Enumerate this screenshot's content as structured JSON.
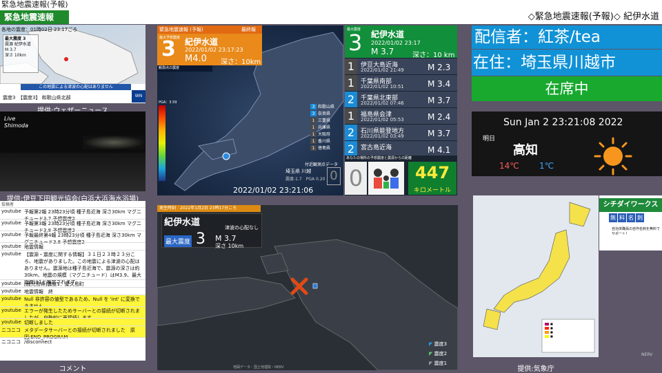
{
  "top": {
    "title": "緊急地震速報(予報)"
  },
  "ticker": {
    "label": "緊急地震速報",
    "text": "◇緊急地震速報(予報)◇ 紀伊水道"
  },
  "weathernews": {
    "header": "各地の震度：01時02日 23:17ごろ",
    "box_title": "最大震度 3",
    "box_lines": [
      "震源 紀伊水道",
      "M 3.7",
      "深さ 10km"
    ],
    "banner": "この地震による津波の心配はありません",
    "footer": "震度3　【震度3】 和歌山県北部",
    "logo": "WN",
    "caption": "提供:ウェザーニュース"
  },
  "camera": {
    "logo": "Live Shimoda",
    "caption": "提供:伊豆下田観光協会(白浜大浜海水浴場)"
  },
  "comments": {
    "header": "投稿者",
    "rows": [
      {
        "src": "youtube",
        "msg": "予報第2報 23時23分頃 種子島近海 深さ30km マグニチュード3.7 予想震度2",
        "yellow": false
      },
      {
        "src": "youtube",
        "msg": "予報第3報 23時23分頃 種子島近海 深さ30km マグニチュード3.8 予想震度2",
        "yellow": false
      },
      {
        "src": "youtube",
        "msg": "予報最終第4報 23時23分頃 種子島近海 深さ30km マグニチュード3.8 予想震度2",
        "yellow": false
      },
      {
        "src": "youtube",
        "msg": "地震情報",
        "yellow": false
      },
      {
        "src": "youtube",
        "msg": "【震源・震度に関する情報】３１日２３時２３分ころ、地震がありました。この地震による津波の心配はありません。震源地は種子島近海で、震源の深さは約30km、地震の規模（マグニチュード）はM3.9、最大震度は1と推定されます。",
        "yellow": false
      },
      {
        "src": "youtube",
        "msg": "[鹿児島県]震度1：屋久島町",
        "yellow": false
      },
      {
        "src": "youtube",
        "msg": "地震情報　終",
        "yellow": false
      },
      {
        "src": "youtube",
        "msg": "Null 非許容の値型であるため、Null を 'int' に変換できません",
        "yellow": true
      },
      {
        "src": "youtube",
        "msg": "エラーが発生したためサーバーとの接続が切断されましたが、自動的に再接続します",
        "yellow": true
      },
      {
        "src": "youtube",
        "msg": "切断しました",
        "yellow": true
      },
      {
        "src": "ニコニコ",
        "msg": "メタデータサーバーとの接続が切断されました　原因:END_PROGRAM",
        "yellow": true
      },
      {
        "src": "ニコニコ",
        "msg": "/disconnect",
        "yellow": false
      }
    ],
    "caption": "コメント"
  },
  "main": {
    "head": "緊急地震速報 (予報)",
    "final": "最終報",
    "int_label": "最大予想震度",
    "intensity": "3",
    "name": "紀伊水道",
    "time": "2022/01/02 23:17:23",
    "mag": "M4.0",
    "depth": "深さ：10km",
    "legend_head": "観測点の震度",
    "pga": "PGA：3.59",
    "cities": [
      {
        "n": "3",
        "name": "和歌山県",
        "color": "#1a8bd6"
      },
      {
        "n": "3",
        "name": "奈良県",
        "color": "#1a8bd6"
      },
      {
        "n": "1",
        "name": "三重県",
        "color": "#4a4a4a"
      },
      {
        "n": "1",
        "name": "兵庫県",
        "color": "#4a4a4a"
      },
      {
        "n": "1",
        "name": "大阪府",
        "color": "#4a4a4a"
      },
      {
        "n": "1",
        "name": "香川県",
        "color": "#4a4a4a"
      },
      {
        "n": "1",
        "name": "徳島県",
        "color": "#4a4a4a"
      }
    ],
    "nearby_label": "付近観測点データ",
    "nearby": "埼玉県 川越",
    "nearby_pga": "震度-1.7　PGA 0.20",
    "nearby_val": "0",
    "clock": "2022/01/02 23:21:06"
  },
  "list": {
    "label": "最大震度",
    "intensity": "3",
    "name": "紀伊水道",
    "time": "2022/01/02 23:17",
    "mag": "M 3.7",
    "depth": "深さ：10 km",
    "items": [
      {
        "n": "1",
        "place": "伊豆大島近海",
        "time": "2022/01/02 21:49",
        "mag": "M 2.3",
        "color": "#4a4a4a"
      },
      {
        "n": "1",
        "place": "千葉県南部",
        "time": "2022/01/02 10:51",
        "mag": "M 3.4",
        "color": "#4a4a4a"
      },
      {
        "n": "2",
        "place": "千葉県北東部",
        "time": "2022/01/02 07:46",
        "mag": "M 3.7",
        "color": "#1a8bd6"
      },
      {
        "n": "1",
        "place": "福島県会津",
        "time": "2022/01/02 05:53",
        "mag": "M 2.4",
        "color": "#4a4a4a"
      },
      {
        "n": "2",
        "place": "石川県能登地方",
        "time": "2022/01/02 03:49",
        "mag": "M 3.7",
        "color": "#1a8bd6"
      },
      {
        "n": "2",
        "place": "宮古島近海",
        "time": "",
        "mag": "M 4.1",
        "color": "#1a8bd6"
      }
    ],
    "dist_head": "あなたの場所の予想震度と震源からの距離",
    "dist_int": "0",
    "dist_km": "447",
    "dist_unit": "キロメートル"
  },
  "streamer": {
    "name": "配信者：紅茶/tea",
    "home": "在住：埼玉県川越市",
    "status": "在席中"
  },
  "clockweather": {
    "clock": "Sun Jan  2 23:21:08 2022",
    "tomorrow": "明日",
    "city": "高知",
    "hi": "14℃",
    "lo": "1℃"
  },
  "jma": {
    "caption": "提供:気象庁",
    "credit": "NERV"
  },
  "ad": {
    "title": "シチダイワークス",
    "tags": [
      "無",
      "料",
      "名",
      "刺"
    ],
    "text": "自治体職員の自作名刺を無料でサポート！"
  },
  "bottom": {
    "head": "発生時刻　2022年1月2日 23時17分ころ",
    "name": "紀伊水道",
    "int_label": "最大震度",
    "intensity": "3",
    "tsunami": "津波の心配なし",
    "mag": "M 3.7",
    "depth": "深さ 10km",
    "legend": [
      "震度3",
      "震度2",
      "震度1"
    ],
    "credit": "地図データ：国土地理院・NERV"
  }
}
